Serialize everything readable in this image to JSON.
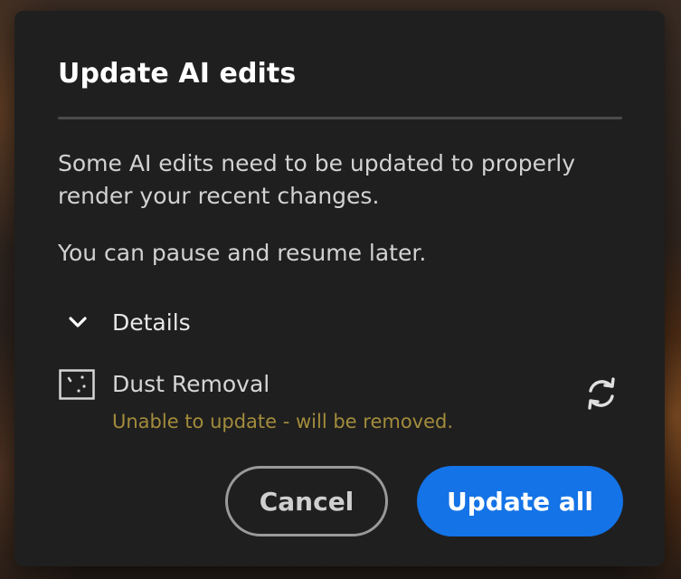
{
  "dialog": {
    "title": "Update AI edits",
    "message_1": "Some AI edits need to be updated to properly render your recent changes.",
    "message_2": "You can pause and resume later.",
    "details": {
      "label": "Details",
      "expanded": true,
      "icon": "chevron-down-icon",
      "items": [
        {
          "name": "Dust Removal",
          "status": "Unable to update - will be removed.",
          "status_color": "#a38c3c",
          "icon": "dust-removal-icon",
          "action_icon": "refresh-icon"
        }
      ]
    },
    "buttons": {
      "cancel_label": "Cancel",
      "update_all_label": "Update all"
    }
  },
  "colors": {
    "dialog_background": "#1f1f1f",
    "accent": "#1473e6",
    "warning_text": "#a38c3c"
  }
}
